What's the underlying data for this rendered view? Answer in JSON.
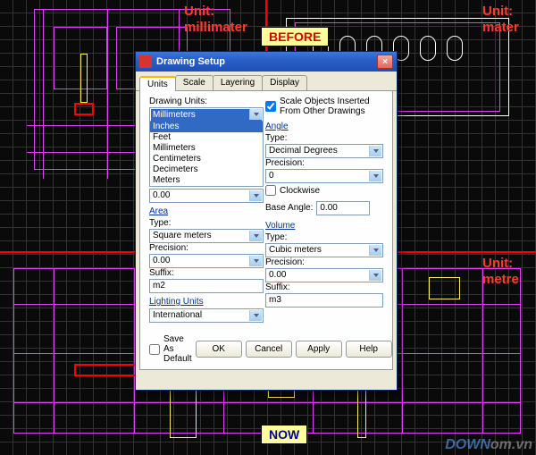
{
  "labels": {
    "before": "BEFORE",
    "now": "NOW",
    "unit_tl_1": "Unit:",
    "unit_tl_2": "millimater",
    "unit_tr_1": "Unit:",
    "unit_tr_2": "mater",
    "unit_br_1": "Unit:",
    "unit_br_2": "metre",
    "watermark_blue": "DOWN",
    "watermark_gray": "om.vn"
  },
  "dialog": {
    "title": "Drawing Setup",
    "tabs": [
      "Units",
      "Scale",
      "Layering",
      "Display"
    ],
    "active_tab": 0,
    "drawing_units": {
      "label": "Drawing Units:",
      "selected": "Millimeters",
      "options": [
        "Inches",
        "Feet",
        "Millimeters",
        "Centimeters",
        "Decimeters",
        "Meters"
      ],
      "highlighted": "Inches",
      "value": "0.00"
    },
    "area": {
      "title": "Area",
      "type_label": "Type:",
      "type_value": "Square meters",
      "precision_label": "Precision:",
      "precision_value": "0.00",
      "suffix_label": "Suffix:",
      "suffix_value": "m2"
    },
    "lighting": {
      "title": "Lighting Units",
      "value": "International"
    },
    "scale_check": {
      "label": "Scale Objects Inserted From Other Drawings",
      "checked": true
    },
    "angle": {
      "title": "Angle",
      "type_label": "Type:",
      "type_value": "Decimal Degrees",
      "precision_label": "Precision:",
      "precision_value": "0",
      "clockwise_label": "Clockwise",
      "clockwise_checked": false,
      "base_label": "Base Angle:",
      "base_value": "0.00"
    },
    "volume": {
      "title": "Volume",
      "type_label": "Type:",
      "type_value": "Cubic meters",
      "precision_label": "Precision:",
      "precision_value": "0.00",
      "suffix_label": "Suffix:",
      "suffix_value": "m3"
    },
    "save_default": {
      "label": "Save As Default",
      "checked": false
    },
    "buttons": {
      "ok": "OK",
      "cancel": "Cancel",
      "apply": "Apply",
      "help": "Help"
    }
  }
}
